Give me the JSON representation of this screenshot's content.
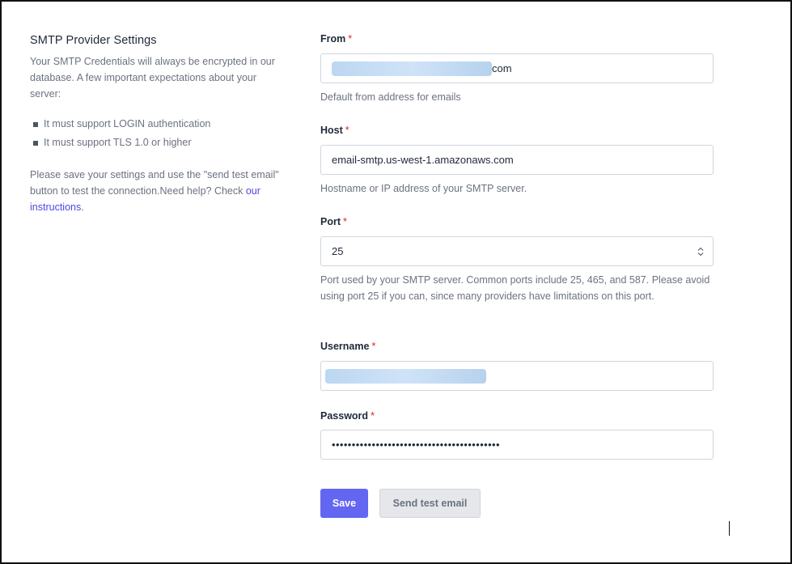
{
  "left": {
    "title": "SMTP Provider Settings",
    "description": "Your SMTP Credentials will always be encrypted in our database. A few important expectations about your server:",
    "bullets": [
      "It must support LOGIN authentication",
      "It must support TLS 1.0 or higher"
    ],
    "note_prefix": "Please save your settings and use the \"send test email\" button to test the connection.Need help? Check ",
    "note_link": "our instructions",
    "note_suffix": "."
  },
  "form": {
    "required_marker": "*",
    "from": {
      "label": "From",
      "value_visible_suffix": "com",
      "help": "Default from address for emails"
    },
    "host": {
      "label": "Host",
      "value": "email-smtp.us-west-1.amazonaws.com",
      "help": "Hostname or IP address of your SMTP server."
    },
    "port": {
      "label": "Port",
      "value": "25",
      "help": "Port used by your SMTP server. Common ports include 25, 465, and 587. Please avoid using port 25 if you can, since many providers have limitations on this port."
    },
    "username": {
      "label": "Username"
    },
    "password": {
      "label": "Password",
      "masked_value": "••••••••••••••••••••••••••••••••••••••••••"
    }
  },
  "actions": {
    "save_label": "Save",
    "test_label": "Send test email"
  },
  "colors": {
    "primary": "#6366f1",
    "link": "#4f46e5",
    "required": "#dc2626"
  }
}
